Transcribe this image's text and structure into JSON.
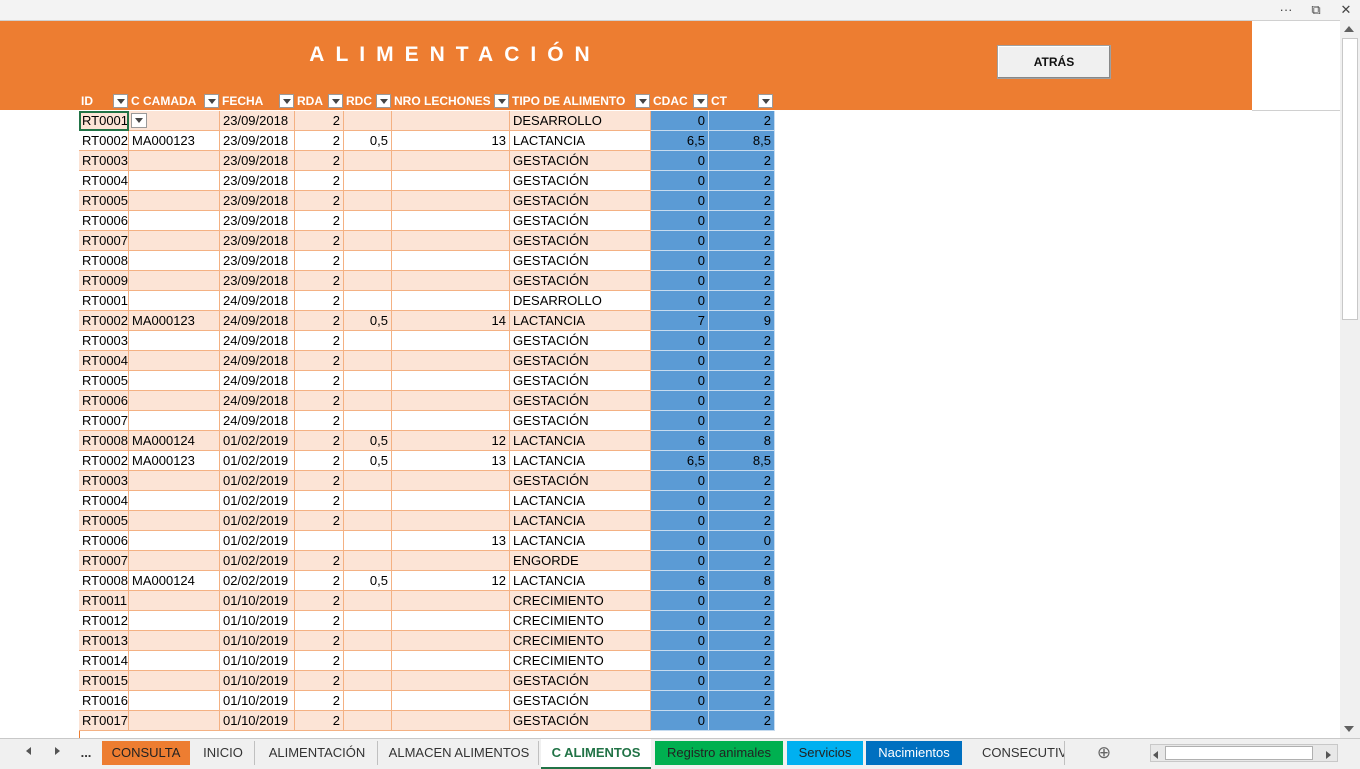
{
  "window": {
    "more_label": "···",
    "restore_label": "⧉",
    "close_label": "✕"
  },
  "banner": {
    "title": "ALIMENTACIÓN",
    "back_button": "ATRÁS"
  },
  "columns": [
    "ID",
    "C CAMADA",
    "FECHA",
    "RDA",
    "RDC",
    "NRO LECHONES",
    "TIPO DE ALIMENTO",
    "CDAC",
    "CT"
  ],
  "rows": [
    [
      "RT0001",
      "",
      "23/09/2018",
      "2",
      "",
      "",
      "DESARROLLO",
      "0",
      "2"
    ],
    [
      "RT0002",
      "MA000123",
      "23/09/2018",
      "2",
      "0,5",
      "13",
      "LACTANCIA",
      "6,5",
      "8,5"
    ],
    [
      "RT0003",
      "",
      "23/09/2018",
      "2",
      "",
      "",
      "GESTACIÓN",
      "0",
      "2"
    ],
    [
      "RT0004",
      "",
      "23/09/2018",
      "2",
      "",
      "",
      "GESTACIÓN",
      "0",
      "2"
    ],
    [
      "RT0005",
      "",
      "23/09/2018",
      "2",
      "",
      "",
      "GESTACIÓN",
      "0",
      "2"
    ],
    [
      "RT0006",
      "",
      "23/09/2018",
      "2",
      "",
      "",
      "GESTACIÓN",
      "0",
      "2"
    ],
    [
      "RT0007",
      "",
      "23/09/2018",
      "2",
      "",
      "",
      "GESTACIÓN",
      "0",
      "2"
    ],
    [
      "RT0008",
      "",
      "23/09/2018",
      "2",
      "",
      "",
      "GESTACIÓN",
      "0",
      "2"
    ],
    [
      "RT0009",
      "",
      "23/09/2018",
      "2",
      "",
      "",
      "GESTACIÓN",
      "0",
      "2"
    ],
    [
      "RT0001",
      "",
      "24/09/2018",
      "2",
      "",
      "",
      "DESARROLLO",
      "0",
      "2"
    ],
    [
      "RT0002",
      "MA000123",
      "24/09/2018",
      "2",
      "0,5",
      "14",
      "LACTANCIA",
      "7",
      "9"
    ],
    [
      "RT0003",
      "",
      "24/09/2018",
      "2",
      "",
      "",
      "GESTACIÓN",
      "0",
      "2"
    ],
    [
      "RT0004",
      "",
      "24/09/2018",
      "2",
      "",
      "",
      "GESTACIÓN",
      "0",
      "2"
    ],
    [
      "RT0005",
      "",
      "24/09/2018",
      "2",
      "",
      "",
      "GESTACIÓN",
      "0",
      "2"
    ],
    [
      "RT0006",
      "",
      "24/09/2018",
      "2",
      "",
      "",
      "GESTACIÓN",
      "0",
      "2"
    ],
    [
      "RT0007",
      "",
      "24/09/2018",
      "2",
      "",
      "",
      "GESTACIÓN",
      "0",
      "2"
    ],
    [
      "RT0008",
      "MA000124",
      "01/02/2019",
      "2",
      "0,5",
      "12",
      "LACTANCIA",
      "6",
      "8"
    ],
    [
      "RT0002",
      "MA000123",
      "01/02/2019",
      "2",
      "0,5",
      "13",
      "LACTANCIA",
      "6,5",
      "8,5"
    ],
    [
      "RT0003",
      "",
      "01/02/2019",
      "2",
      "",
      "",
      "GESTACIÓN",
      "0",
      "2"
    ],
    [
      "RT0004",
      "",
      "01/02/2019",
      "2",
      "",
      "",
      "LACTANCIA",
      "0",
      "2"
    ],
    [
      "RT0005",
      "",
      "01/02/2019",
      "2",
      "",
      "",
      "LACTANCIA",
      "0",
      "2"
    ],
    [
      "RT0006",
      "",
      "01/02/2019",
      "",
      "",
      "13",
      "LACTANCIA",
      "0",
      "0"
    ],
    [
      "RT0007",
      "",
      "01/02/2019",
      "2",
      "",
      "",
      "ENGORDE",
      "0",
      "2"
    ],
    [
      "RT0008",
      "MA000124",
      "02/02/2019",
      "2",
      "0,5",
      "12",
      "LACTANCIA",
      "6",
      "8"
    ],
    [
      "RT0011",
      "",
      "01/10/2019",
      "2",
      "",
      "",
      "CRECIMIENTO",
      "0",
      "2"
    ],
    [
      "RT0012",
      "",
      "01/10/2019",
      "2",
      "",
      "",
      "CRECIMIENTO",
      "0",
      "2"
    ],
    [
      "RT0013",
      "",
      "01/10/2019",
      "2",
      "",
      "",
      "CRECIMIENTO",
      "0",
      "2"
    ],
    [
      "RT0014",
      "",
      "01/10/2019",
      "2",
      "",
      "",
      "CRECIMIENTO",
      "0",
      "2"
    ],
    [
      "RT0015",
      "",
      "01/10/2019",
      "2",
      "",
      "",
      "GESTACIÓN",
      "0",
      "2"
    ],
    [
      "RT0016",
      "",
      "01/10/2019",
      "2",
      "",
      "",
      "GESTACIÓN",
      "0",
      "2"
    ],
    [
      "RT0017",
      "",
      "01/10/2019",
      "2",
      "",
      "",
      "GESTACIÓN",
      "0",
      "2"
    ]
  ],
  "tabs": [
    {
      "label": "CONSULTA",
      "bg": "#ed7d31",
      "color": "#222222"
    },
    {
      "label": "INICIO",
      "bg": "",
      "color": "#333333"
    },
    {
      "label": "ALIMENTACIÓN",
      "bg": "",
      "color": "#333333"
    },
    {
      "label": "ALMACEN ALIMENTOS",
      "bg": "",
      "color": "#333333"
    },
    {
      "label": "C ALIMENTOS",
      "bg": "#ffffff",
      "color": "#217346"
    },
    {
      "label": "Registro animales",
      "bg": "#00b050",
      "color": "#222222"
    },
    {
      "label": "Servicios",
      "bg": "#00b0f0",
      "color": "#222222"
    },
    {
      "label": "Nacimientos",
      "bg": "#0070c0",
      "color": "#ffffff"
    },
    {
      "label": "CONSECUTIVO",
      "bg": "",
      "color": "#333333"
    }
  ],
  "tab_nav": {
    "more_label": "...",
    "add_label": "⊕"
  },
  "colors": {
    "accent": "#ed7d31",
    "band": "#fce4d6",
    "calc": "#5b9bd5",
    "selection": "#217346"
  }
}
